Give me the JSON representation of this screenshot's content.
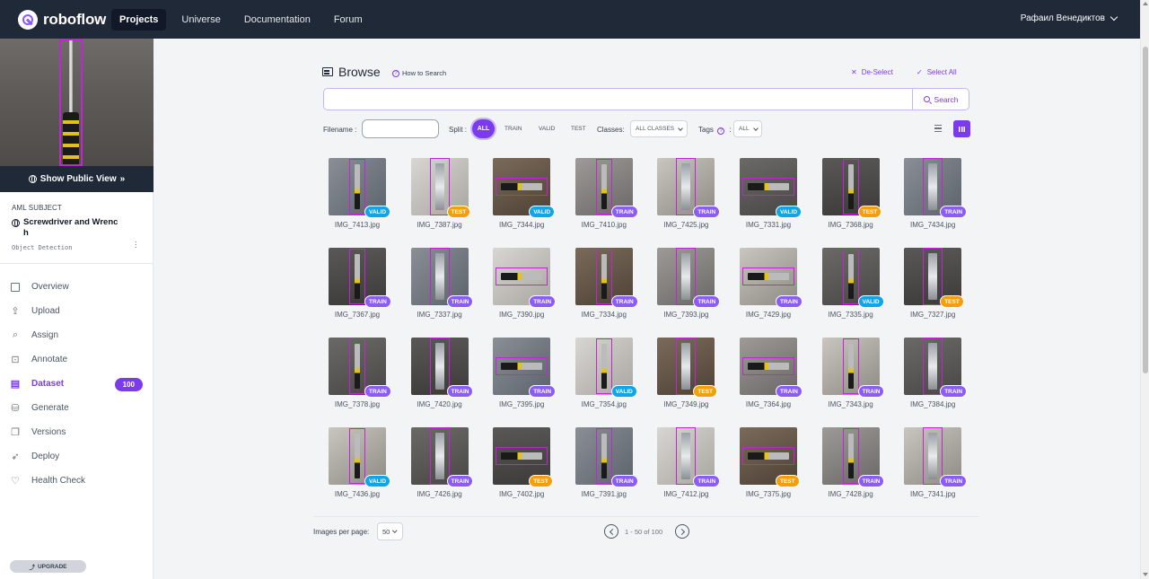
{
  "nav": {
    "logo": "roboflow",
    "links": [
      "Projects",
      "Universe",
      "Documentation",
      "Forum"
    ],
    "user": "Рафаил Венедиктов"
  },
  "sidebar": {
    "public_view": "Show Public View",
    "project_group": "AML SUBJECT",
    "project_name": "Screwdriver and Wrenc h",
    "project_type": "Object Detection",
    "items": [
      {
        "label": "Overview",
        "icon": "overview-icon"
      },
      {
        "label": "Upload",
        "icon": "upload-icon"
      },
      {
        "label": "Assign",
        "icon": "assign-icon"
      },
      {
        "label": "Annotate",
        "icon": "annotate-icon"
      },
      {
        "label": "Dataset",
        "icon": "dataset-icon",
        "badge": "100"
      },
      {
        "label": "Generate",
        "icon": "generate-icon"
      },
      {
        "label": "Versions",
        "icon": "versions-icon"
      },
      {
        "label": "Deploy",
        "icon": "deploy-icon"
      },
      {
        "label": "Health Check",
        "icon": "health-check-icon"
      }
    ],
    "upgrade": "UPGRADE"
  },
  "browse": {
    "title": "Browse",
    "how_to": "How to Search",
    "deselect": "De-Select",
    "select_all": "Select All",
    "search_value": "",
    "search_button": "Search",
    "filename_label": "Filename :",
    "split_label": "Split :",
    "split_options": [
      "ALL",
      "TRAIN",
      "VALID",
      "TEST"
    ],
    "classes_label": "Classes:",
    "classes_value": "ALL CLASSES",
    "tags_label": "Tags",
    "tags_value": "ALL"
  },
  "images": [
    {
      "name": "IMG_7413.jpg",
      "split": "VALID"
    },
    {
      "name": "IMG_7387.jpg",
      "split": "TEST"
    },
    {
      "name": "IMG_7344.jpg",
      "split": "VALID"
    },
    {
      "name": "IMG_7410.jpg",
      "split": "TRAIN"
    },
    {
      "name": "IMG_7425.jpg",
      "split": "TRAIN"
    },
    {
      "name": "IMG_7331.jpg",
      "split": "VALID"
    },
    {
      "name": "IMG_7368.jpg",
      "split": "TEST"
    },
    {
      "name": "IMG_7434.jpg",
      "split": "TRAIN"
    },
    {
      "name": "IMG_7367.jpg",
      "split": "TRAIN"
    },
    {
      "name": "IMG_7337.jpg",
      "split": "TRAIN"
    },
    {
      "name": "IMG_7390.jpg",
      "split": "TRAIN"
    },
    {
      "name": "IMG_7334.jpg",
      "split": "TRAIN"
    },
    {
      "name": "IMG_7393.jpg",
      "split": "TRAIN"
    },
    {
      "name": "IMG_7429.jpg",
      "split": "TRAIN"
    },
    {
      "name": "IMG_7335.jpg",
      "split": "VALID"
    },
    {
      "name": "IMG_7327.jpg",
      "split": "TEST"
    },
    {
      "name": "IMG_7378.jpg",
      "split": "TRAIN"
    },
    {
      "name": "IMG_7420.jpg",
      "split": "TRAIN"
    },
    {
      "name": "IMG_7395.jpg",
      "split": "TRAIN"
    },
    {
      "name": "IMG_7354.jpg",
      "split": "VALID"
    },
    {
      "name": "IMG_7349.jpg",
      "split": "TEST"
    },
    {
      "name": "IMG_7364.jpg",
      "split": "TRAIN"
    },
    {
      "name": "IMG_7343.jpg",
      "split": "TRAIN"
    },
    {
      "name": "IMG_7384.jpg",
      "split": "TRAIN"
    },
    {
      "name": "IMG_7436.jpg",
      "split": "VALID"
    },
    {
      "name": "IMG_7426.jpg",
      "split": "TRAIN"
    },
    {
      "name": "IMG_7402.jpg",
      "split": "TEST"
    },
    {
      "name": "IMG_7391.jpg",
      "split": "TRAIN"
    },
    {
      "name": "IMG_7412.jpg",
      "split": "TRAIN"
    },
    {
      "name": "IMG_7375.jpg",
      "split": "TEST"
    },
    {
      "name": "IMG_7428.jpg",
      "split": "TRAIN"
    },
    {
      "name": "IMG_7341.jpg",
      "split": "TRAIN"
    }
  ],
  "pagination": {
    "per_page_label": "Images per page:",
    "per_page_value": "50",
    "range_text": "1 - 50 of 100"
  },
  "colors": {
    "accent": "#7c3aed",
    "nav_bg": "#1f2937",
    "train": "#8b5cf6",
    "valid": "#0ea5e9",
    "test": "#f59e0b"
  }
}
